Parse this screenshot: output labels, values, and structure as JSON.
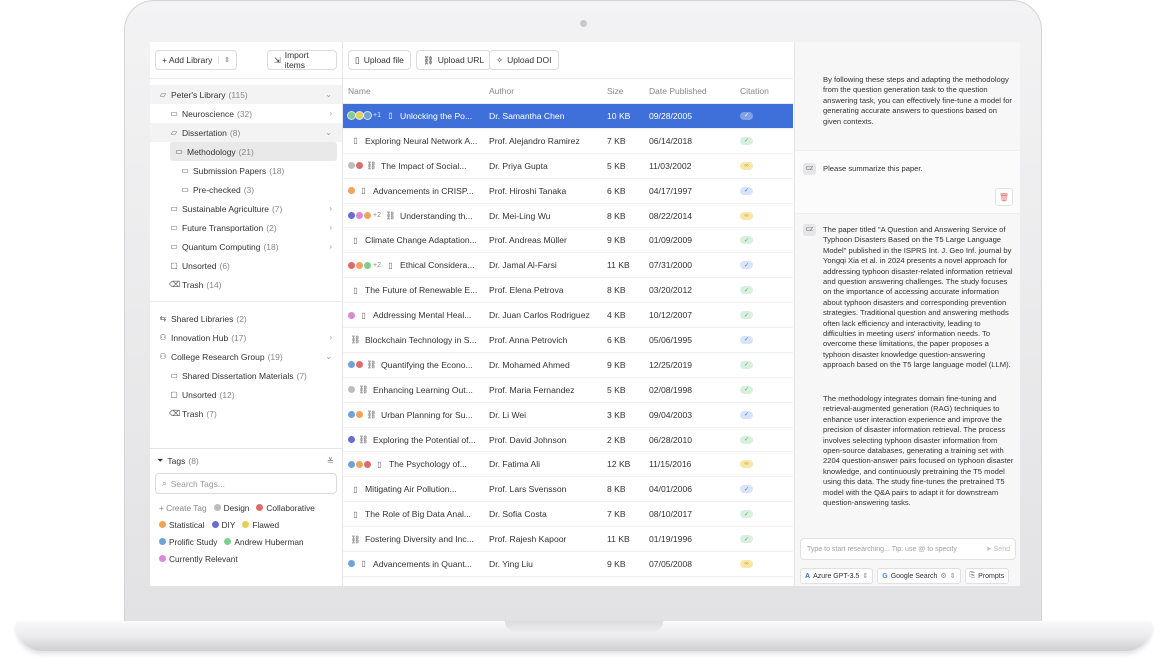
{
  "library": {
    "add_library": "+ Add Library",
    "import_items": "Import items",
    "tree": [
      {
        "label": "Peter's Library",
        "count": "(115)",
        "level": 0,
        "icon": "folder-open-icon",
        "chevron": "⌄",
        "state": "hl"
      },
      {
        "label": "Neuroscience",
        "count": "(32)",
        "level": 1,
        "icon": "folder-icon",
        "chevron": "›",
        "state": ""
      },
      {
        "label": "Dissertation",
        "count": "(8)",
        "level": 1,
        "icon": "folder-open-icon",
        "chevron": "⌄",
        "state": "hl"
      },
      {
        "label": "Methodology",
        "count": "(21)",
        "level": 2,
        "icon": "folder-icon",
        "chevron": "",
        "state": "sel"
      },
      {
        "label": "Submission Papers",
        "count": "(18)",
        "level": 2,
        "icon": "folder-icon",
        "chevron": "",
        "state": ""
      },
      {
        "label": "Pre-checked",
        "count": "(3)",
        "level": 2,
        "icon": "folder-icon",
        "chevron": "",
        "state": ""
      },
      {
        "label": "Sustainable Agriculture",
        "count": "(7)",
        "level": 1,
        "icon": "folder-icon",
        "chevron": "›",
        "state": ""
      },
      {
        "label": "Future Transportation",
        "count": "(2)",
        "level": 1,
        "icon": "folder-icon",
        "chevron": "›",
        "state": ""
      },
      {
        "label": "Quantum Computing",
        "count": "(18)",
        "level": 1,
        "icon": "folder-icon",
        "chevron": "›",
        "state": ""
      },
      {
        "label": "Unsorted",
        "count": "(6)",
        "level": 1,
        "icon": "unsorted-icon",
        "chevron": "",
        "state": ""
      },
      {
        "label": "Trash",
        "count": "(14)",
        "level": 1,
        "icon": "trash-icon",
        "chevron": "",
        "state": ""
      }
    ],
    "groups": [
      {
        "label": "Shared Libraries",
        "count": "(2)",
        "level": 0,
        "icon": "share-icon",
        "chevron": ""
      },
      {
        "label": "Innovation Hub",
        "count": "(17)",
        "level": 0,
        "icon": "group-icon",
        "chevron": "›"
      },
      {
        "label": "College Research Group",
        "count": "(19)",
        "level": 0,
        "icon": "group-icon",
        "chevron": "⌄"
      },
      {
        "label": "Shared Dissertation Materials",
        "count": "(7)",
        "level": 1,
        "icon": "folder-icon",
        "chevron": ""
      },
      {
        "label": "Unsorted",
        "count": "(12)",
        "level": 1,
        "icon": "unsorted-icon",
        "chevron": ""
      },
      {
        "label": "Trash",
        "count": "(7)",
        "level": 1,
        "icon": "trash-icon",
        "chevron": ""
      }
    ]
  },
  "tags": {
    "title": "Tags",
    "count": "(8)",
    "search_placeholder": "Search Tags...",
    "create": "+ Create Tag",
    "items": [
      {
        "label": "Design",
        "color": "#bdbdbd"
      },
      {
        "label": "Collaborative",
        "color": "#e06a6a"
      },
      {
        "label": "Statistical",
        "color": "#f0a35c"
      },
      {
        "label": "DIY",
        "color": "#6b6bd6"
      },
      {
        "label": "Flawed",
        "color": "#e8cf5a"
      },
      {
        "label": "Prolific Study",
        "color": "#6fa3d8"
      },
      {
        "label": "Andrew Huberman",
        "color": "#7dcf8a"
      },
      {
        "label": "Currently Relevant",
        "color": "#d88ad8"
      }
    ]
  },
  "toolbar": {
    "upload_file": "Upload file",
    "upload_url": "Upload URL",
    "upload_doi": "Upload DOI"
  },
  "table": {
    "headers": {
      "name": "Name",
      "author": "Author",
      "size": "Size",
      "date": "Date Published",
      "citation": "Citation"
    },
    "rows": [
      {
        "dots": [
          "#7dcf8a",
          "#e8cf5a",
          "#6fa3d8"
        ],
        "more": "+1",
        "type": "file-icon",
        "title": "Unlocking the Po...",
        "author": "Dr. Samantha Chen",
        "size": "10 KB",
        "date": "09/28/2005",
        "cite": "check",
        "selected": true
      },
      {
        "dots": [],
        "more": "",
        "type": "file-icon",
        "title": "Exploring Neural Network A...",
        "author": "Prof. Alejandro Ramirez",
        "size": "7 KB",
        "date": "06/14/2018",
        "cite": "check",
        "selected": false
      },
      {
        "dots": [
          "#bdbdbd",
          "#e06a6a"
        ],
        "more": "",
        "type": "link-icon",
        "title": "The Impact of Social...",
        "author": "Dr. Priya Gupta",
        "size": "5 KB",
        "date": "11/03/2002",
        "cite": "link",
        "selected": false
      },
      {
        "dots": [
          "#f0a35c"
        ],
        "more": "",
        "type": "file-icon",
        "title": "Advancements in CRISP...",
        "author": "Prof. Hiroshi Tanaka",
        "size": "6 KB",
        "date": "04/17/1997",
        "cite": "check",
        "selected": false
      },
      {
        "dots": [
          "#6b6bd6",
          "#d88ad8",
          "#f0a35c"
        ],
        "more": "+2",
        "type": "link-icon",
        "title": "Understanding th...",
        "author": "Dr. Mei-Ling Wu",
        "size": "8 KB",
        "date": "08/22/2014",
        "cite": "link",
        "selected": false
      },
      {
        "dots": [],
        "more": "",
        "type": "file-icon",
        "title": "Climate Change Adaptation...",
        "author": "Prof. Andreas Müller",
        "size": "9 KB",
        "date": "01/09/2009",
        "cite": "check",
        "selected": false
      },
      {
        "dots": [
          "#e06a6a",
          "#f0a35c",
          "#7dcf8a"
        ],
        "more": "+2",
        "type": "file-icon",
        "title": "Ethical Considera...",
        "author": "Dr. Jamal Al-Farsi",
        "size": "11 KB",
        "date": "07/31/2000",
        "cite": "check",
        "selected": false
      },
      {
        "dots": [],
        "more": "",
        "type": "file-icon",
        "title": "The Future of Renewable E...",
        "author": "Prof. Elena Petrova",
        "size": "8 KB",
        "date": "03/20/2012",
        "cite": "check",
        "selected": false
      },
      {
        "dots": [
          "#d88ad8"
        ],
        "more": "",
        "type": "file-icon",
        "title": "Addressing Mental Heal...",
        "author": "Dr. Juan Carlos Rodriguez",
        "size": "4 KB",
        "date": "10/12/2007",
        "cite": "check",
        "selected": false
      },
      {
        "dots": [],
        "more": "",
        "type": "link-icon",
        "title": "Blockchain Technology in S...",
        "author": "Prof. Anna Petrovich",
        "size": "6 KB",
        "date": "05/06/1995",
        "cite": "check",
        "selected": false
      },
      {
        "dots": [
          "#6fa3d8",
          "#e06a6a"
        ],
        "more": "",
        "type": "link-icon",
        "title": "Quantifying the Econo...",
        "author": "Dr. Mohamed Ahmed",
        "size": "9 KB",
        "date": "12/25/2019",
        "cite": "check",
        "selected": false
      },
      {
        "dots": [
          "#bdbdbd"
        ],
        "more": "",
        "type": "link-icon",
        "title": "Enhancing Learning Out...",
        "author": "Prof. Maria Fernandez",
        "size": "5 KB",
        "date": "02/08/1998",
        "cite": "check",
        "selected": false
      },
      {
        "dots": [
          "#6fa3d8",
          "#f0a35c"
        ],
        "more": "",
        "type": "link-icon",
        "title": "Urban Planning for Su...",
        "author": "Dr. Li Wei",
        "size": "3 KB",
        "date": "09/04/2003",
        "cite": "check",
        "selected": false
      },
      {
        "dots": [
          "#6b6bd6"
        ],
        "more": "",
        "type": "link-icon",
        "title": "Exploring the Potential of...",
        "author": "Prof. David Johnson",
        "size": "2 KB",
        "date": "06/28/2010",
        "cite": "check",
        "selected": false
      },
      {
        "dots": [
          "#6fa3d8",
          "#f0a35c",
          "#e06a6a"
        ],
        "more": "",
        "type": "file-icon",
        "title": "The Psychology of...",
        "author": "Dr. Fatima Ali",
        "size": "12 KB",
        "date": "11/15/2016",
        "cite": "link",
        "selected": false
      },
      {
        "dots": [],
        "more": "",
        "type": "file-icon",
        "title": "Mitigating Air Pollution...",
        "author": "Prof. Lars Svensson",
        "size": "8 KB",
        "date": "04/01/2006",
        "cite": "check",
        "selected": false
      },
      {
        "dots": [],
        "more": "",
        "type": "file-icon",
        "title": "The Role of Big Data Anal...",
        "author": "Dr. Sofia Costa",
        "size": "7 KB",
        "date": "08/10/2017",
        "cite": "check",
        "selected": false
      },
      {
        "dots": [],
        "more": "",
        "type": "link-icon",
        "title": "Fostering Diversity and Inc...",
        "author": "Prof. Rajesh Kapoor",
        "size": "11 KB",
        "date": "01/19/1996",
        "cite": "check",
        "selected": false
      },
      {
        "dots": [
          "#6fa3d8"
        ],
        "more": "",
        "type": "file-icon",
        "title": "Advancements in Quant...",
        "author": "Dr. Ying Liu",
        "size": "9 KB",
        "date": "07/05/2008",
        "cite": "link",
        "selected": false
      }
    ]
  },
  "chat": {
    "assistant_top": "By following these steps and adapting the methodology from the question generation task to the question answering task, you can effectively fine-tune a model for generating accurate answers to questions based on given contexts.",
    "user_avatar": "CZ",
    "user_message": "Please summarize this paper.",
    "assistant_avatar": "CZ",
    "answer_p1": "The paper titled \"A Question and Answering Service of Typhoon Disasters Based on the T5 Large Language Model\" published in the ISPRS Int. J. Geo Inf. journal by Yongqi Xia et al. in 2024 presents a novel approach for addressing typhoon disaster-related information retrieval and question answering challenges. The study focuses on the importance of accessing accurate information about typhoon disasters and corresponding prevention strategies. Traditional question and answering methods often lack efficiency and interactivity, leading to difficulties in meeting users' information needs. To overcome these limitations, the paper proposes a typhoon disaster knowledge question-answering approach based on the T5 large language model (LLM).",
    "answer_p2": "The methodology integrates domain fine-tuning and retrieval-augmented generation (RAG) techniques to enhance user interaction experience and improve the precision of disaster information retrieval. The process involves selecting typhoon disaster information from open-source databases, generating a training set with 2204 question-answer pairs focused on typhoon disaster knowledge, and continuously pretraining the T5 model using this data. The study fine-tunes the pretrained T5 model with the Q&A pairs to adapt it for downstream question-answering tasks.",
    "input_placeholder": "Type to start researching... Tip: use @ to specify the",
    "send": "Send",
    "model": "Azure GPT-3.5",
    "search": "Google Search",
    "prompts": "Prompts"
  }
}
